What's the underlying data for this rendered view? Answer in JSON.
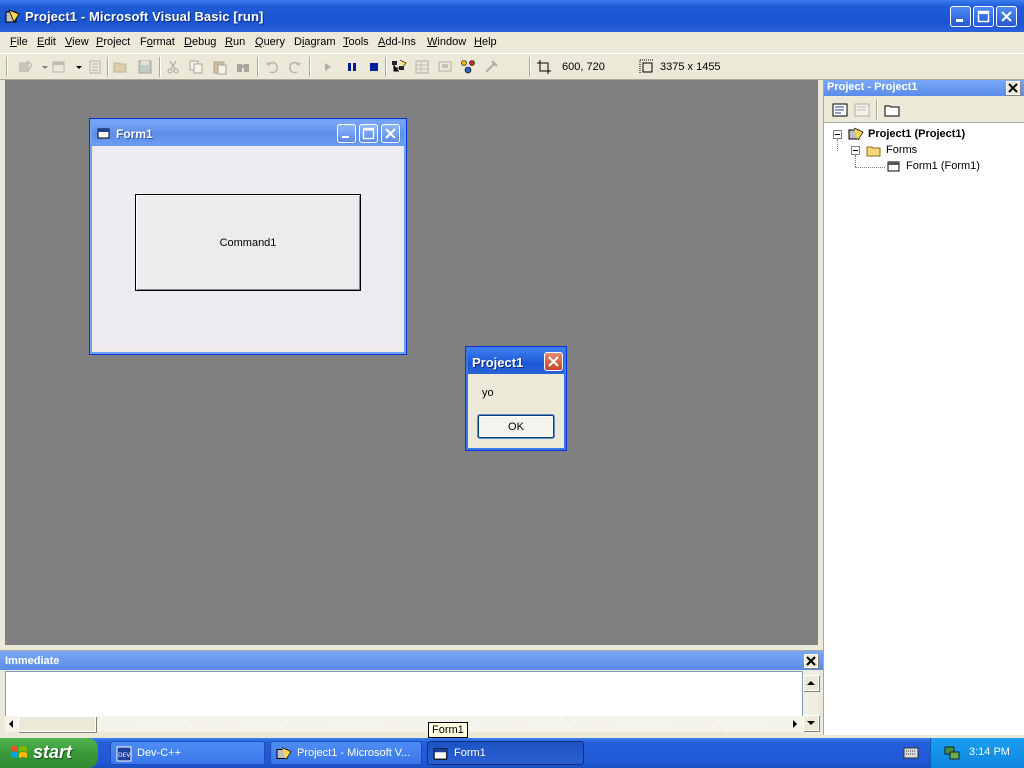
{
  "window": {
    "title": "Project1 - Microsoft Visual Basic [run]"
  },
  "menu": [
    {
      "label": "File",
      "accel": "F"
    },
    {
      "label": "Edit",
      "accel": "E"
    },
    {
      "label": "View",
      "accel": "V"
    },
    {
      "label": "Project",
      "accel": "P"
    },
    {
      "label": "Format",
      "accel": "o"
    },
    {
      "label": "Debug",
      "accel": "D"
    },
    {
      "label": "Run",
      "accel": "R"
    },
    {
      "label": "Query",
      "accel": "Q"
    },
    {
      "label": "Diagram",
      "accel": "i"
    },
    {
      "label": "Tools",
      "accel": "T"
    },
    {
      "label": "Add-Ins",
      "accel": "A"
    },
    {
      "label": "Window",
      "accel": "W"
    },
    {
      "label": "Help",
      "accel": "H"
    }
  ],
  "toolbar": {
    "position": "600, 720",
    "size": "3375 x 1455"
  },
  "form1": {
    "title": "Form1",
    "command_label": "Command1"
  },
  "msgbox": {
    "title": "Project1",
    "message": "yo",
    "ok_label": "OK"
  },
  "project_panel": {
    "title": "Project - Project1",
    "tree": {
      "project": "Project1 (Project1)",
      "folder": "Forms",
      "form": "Form1 (Form1)"
    }
  },
  "immediate": {
    "title": "Immediate"
  },
  "tooltip": "Form1",
  "taskbar": {
    "start_label": "start",
    "tasks": [
      {
        "label": "Dev-C++"
      },
      {
        "label": "Project1 - Microsoft V..."
      },
      {
        "label": "Form1"
      }
    ],
    "clock": "3:14 PM"
  },
  "colors": {
    "xp_blue": "#245edb",
    "start_green": "#3a9a3a",
    "mdi_gray": "#808080"
  }
}
